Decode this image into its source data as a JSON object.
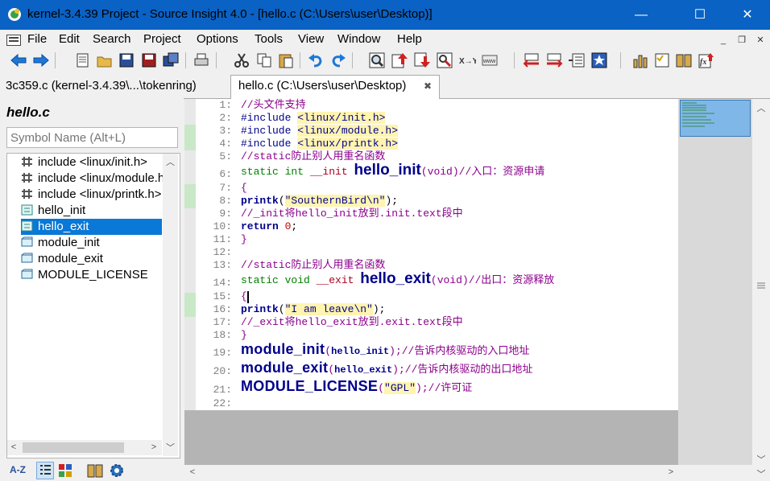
{
  "window": {
    "title": "kernel-3.4.39 Project - Source Insight 4.0 - [hello.c (C:\\Users\\user\\Desktop)]",
    "controls": {
      "minimize": "—",
      "maximize": "☐",
      "close": "✕"
    }
  },
  "menu": {
    "items": [
      "File",
      "Edit",
      "Search",
      "Project",
      "Options",
      "Tools",
      "View",
      "Window",
      "Help"
    ],
    "mdi": {
      "minimize": "_",
      "restore": "❐",
      "close": "✕"
    }
  },
  "toolbar": {
    "icons": [
      "back-arrow-icon",
      "forward-arrow-icon",
      "new-file-icon",
      "open-folder-icon",
      "save-icon",
      "save-all-icon",
      "close-file-icon",
      "print-icon",
      "cut-icon",
      "copy-icon",
      "paste-icon",
      "undo-icon",
      "redo-icon",
      "search-files-icon",
      "jump-up-icon",
      "jump-down-icon",
      "browse-icon",
      "replace-icon",
      "web-icon",
      "bookmark-prev-icon",
      "bookmark-next-icon",
      "list-icon",
      "star-icon",
      "bar-chart-icon",
      "checklist-icon",
      "book-icon",
      "function-icon"
    ]
  },
  "tabs": [
    {
      "label": "3c359.c (kernel-3.4.39\\...\\tokenring)",
      "active": false
    },
    {
      "label": "hello.c (C:\\Users\\user\\Desktop)",
      "active": true,
      "close": "✖"
    }
  ],
  "symbol_pane": {
    "title": "hello.c",
    "search_placeholder": "Symbol Name (Alt+L)",
    "symbols": [
      {
        "label": "include <linux/init.h>",
        "icon": "include-icon"
      },
      {
        "label": "include <linux/module.h>",
        "icon": "include-icon"
      },
      {
        "label": "include <linux/printk.h>",
        "icon": "include-icon"
      },
      {
        "label": "hello_init",
        "icon": "function-icon"
      },
      {
        "label": "hello_exit",
        "icon": "function-icon",
        "selected": true
      },
      {
        "label": "module_init",
        "icon": "macro-icon"
      },
      {
        "label": "module_exit",
        "icon": "macro-icon"
      },
      {
        "label": "MODULE_LICENSE",
        "icon": "macro-icon"
      }
    ],
    "bottom_icons": [
      "sort-az-icon",
      "list-view-icon",
      "category-icon",
      "book-icon",
      "gear-icon"
    ],
    "sort_label": "A-Z"
  },
  "editor": {
    "line_numbers": [
      "1:",
      "2:",
      "3:",
      "4:",
      "5:",
      "6:",
      "7:",
      "8:",
      "9:",
      "10:",
      "11:",
      "12:",
      "13:",
      "14:",
      "15:",
      "16:",
      "17:",
      "18:",
      "19:",
      "20:",
      "21:",
      "22:"
    ],
    "lines": {
      "l1": "//头文件支持",
      "l2_pre": "#include ",
      "l2_inc": "<linux/init.h>",
      "l3_pre": "#include ",
      "l3_inc": "<linux/module.h>",
      "l4_pre": "#include ",
      "l4_inc": "<linux/printk.h>",
      "l5": "//static防止别人用重名函数",
      "l6_kw": "static int ",
      "l6_attr": "__init ",
      "l6_fn": "hello_init",
      "l6_args": "(void)",
      "l6_cm": "//入口：资源申请",
      "l7": "{",
      "l8_kb": "printk",
      "l8_p1": "(",
      "l8_str": "\"SouthernBird\\n\"",
      "l8_p2": ");",
      "l9": "//_init将hello_init放到.init.text段中",
      "l10_kb": "return ",
      "l10_num": "0",
      "l10_end": ";",
      "l11": "}",
      "l13": "//static防止别人用重名函数",
      "l14_kw": "static void ",
      "l14_attr": "__exit ",
      "l14_fn": "hello_exit",
      "l14_args": "(void)",
      "l14_cm": "//出口：资源释放",
      "l15": "{",
      "l16_kb": "printk",
      "l16_p1": "(",
      "l16_str": "\"I am leave\\n\"",
      "l16_p2": ");",
      "l17": "//_exit将hello_exit放到.exit.text段中",
      "l18": "}",
      "l19_mac": "module_init",
      "l19_p1": "(",
      "l19_arg": "hello_init",
      "l19_p2": ");",
      "l19_cm": "//告诉内核驱动的入口地址",
      "l20_mac": "module_exit",
      "l20_p1": "(",
      "l20_arg": "hello_exit",
      "l20_p2": ");",
      "l20_cm": "//告诉内核驱动的出口地址",
      "l21_mac": "MODULE_LICENSE",
      "l21_p1": "(",
      "l21_str": "\"GPL\"",
      "l21_p2": ");",
      "l21_cm": "//许可证"
    }
  },
  "colors": {
    "titlebar": "#0a62c4",
    "selection": "#0a78d7",
    "comment": "#8b008b",
    "keyword": "#008000",
    "identifier": "#00008b"
  }
}
